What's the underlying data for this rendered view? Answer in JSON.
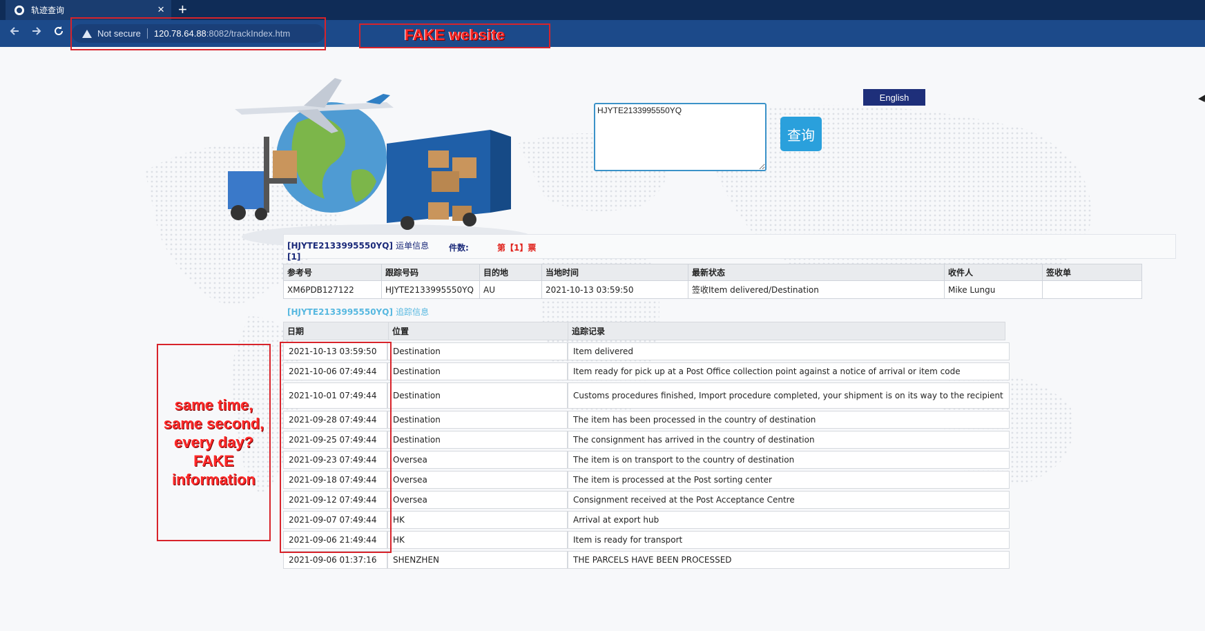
{
  "browser": {
    "tab_title": "轨迹查询",
    "close_glyph": "×",
    "new_tab_glyph": "+",
    "security_label": "Not secure",
    "url_host": "120.78.64.88",
    "url_path": ":8082/trackIndex.htm",
    "icons": [
      "globe-icon",
      "back-icon",
      "forward-icon",
      "reload-icon",
      "warning-icon"
    ]
  },
  "annotations": {
    "fake_website": "FAKE website",
    "same_time": [
      "same time,",
      "same second,",
      "every day?",
      "FAKE",
      "information"
    ],
    "color": "#d8232a"
  },
  "search": {
    "value": "HJYTE2133995550YQ",
    "query_label": "查询",
    "english_label": "English"
  },
  "waybill": {
    "number": "[HJYTE2133995550YQ]",
    "info_label": "运单信息",
    "count_label": "件数:",
    "count_value": "[1]",
    "page_label": "第【1】票"
  },
  "summary": {
    "headers": [
      "参考号",
      "跟踪号码",
      "目的地",
      "当地时间",
      "最新状态",
      "收件人",
      "签收单"
    ],
    "row": [
      "XM6PDB127122",
      "HJYTE2133995550YQ",
      "AU",
      "2021-10-13 03:59:50",
      "签收Item delivered/Destination",
      "Mike Lungu",
      ""
    ]
  },
  "trace": {
    "number": "[HJYTE2133995550YQ]",
    "info_label": "追踪信息",
    "headers": [
      "日期",
      "位置",
      "追踪记录"
    ],
    "rows": [
      {
        "date": "2021-10-13 03:59:50",
        "location": "Destination",
        "record": "Item delivered"
      },
      {
        "date": "2021-10-06 07:49:44",
        "location": "Destination",
        "record": "Item ready for pick up at a Post Office collection point against a notice of arrival or item code"
      },
      {
        "date": "2021-10-01 07:49:44",
        "location": "Destination",
        "record": "Customs procedures finished, Import procedure completed, your shipment is on its way to the recipient"
      },
      {
        "date": "2021-09-28 07:49:44",
        "location": "Destination",
        "record": "The item has been processed in the country of destination"
      },
      {
        "date": "2021-09-25 07:49:44",
        "location": "Destination",
        "record": "The consignment has arrived in the country of destination"
      },
      {
        "date": "2021-09-23 07:49:44",
        "location": "Oversea",
        "record": "The item is on transport to the country of destination"
      },
      {
        "date": "2021-09-18 07:49:44",
        "location": "Oversea",
        "record": "The item is processed at the Post sorting center"
      },
      {
        "date": "2021-09-12 07:49:44",
        "location": "Oversea",
        "record": "Consignment received at the Post Acceptance Centre"
      },
      {
        "date": "2021-09-07 07:49:44",
        "location": "HK",
        "record": "Arrival at export hub"
      },
      {
        "date": "2021-09-06 21:49:44",
        "location": "HK",
        "record": "Item is ready for transport"
      },
      {
        "date": "2021-09-06 01:37:16",
        "location": "SHENZHEN",
        "record": "THE PARCELS HAVE BEEN PROCESSED"
      }
    ]
  }
}
